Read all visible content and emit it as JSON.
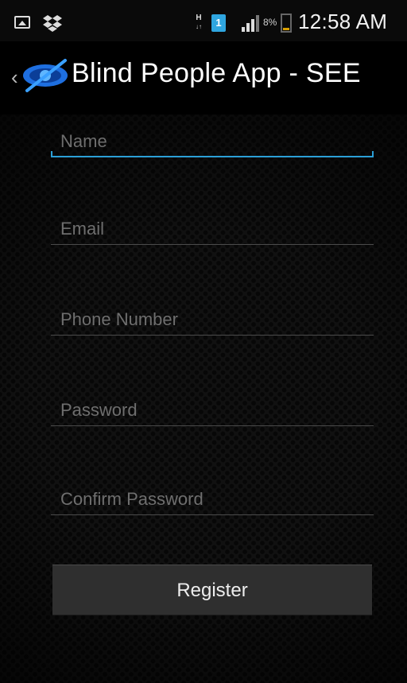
{
  "status_bar": {
    "time": "12:58 AM",
    "battery_percent": "8%",
    "sim_label": "1",
    "network_type": "H",
    "icons": [
      "gallery-icon",
      "dropbox-icon",
      "network-h-icon",
      "sim-card-icon",
      "signal-icon",
      "battery-icon"
    ]
  },
  "action_bar": {
    "title": "Blind People App - SEE",
    "back_icon": "chevron-left-icon",
    "logo_icon": "eye-crossed-logo-icon"
  },
  "form": {
    "name_placeholder": "Name",
    "email_placeholder": "Email",
    "phone_placeholder": "Phone Number",
    "password_placeholder": "Password",
    "confirm_password_placeholder": "Confirm Password",
    "register_label": "Register"
  },
  "colors": {
    "accent_focus": "#2b9fd6",
    "sim_blue": "#2fa6e0",
    "logo_blue": "#1e6fe0"
  }
}
